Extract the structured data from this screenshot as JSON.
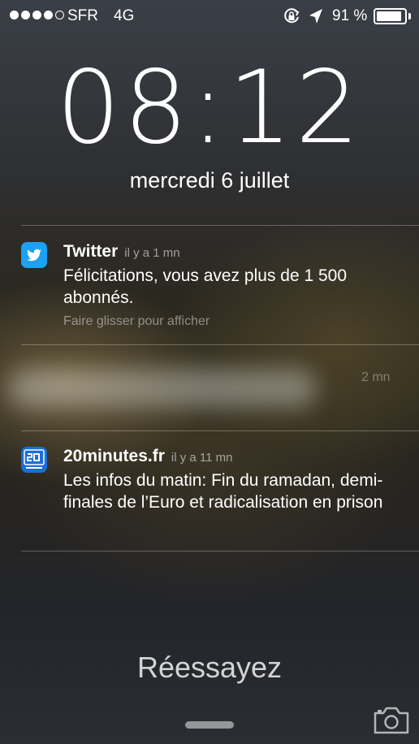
{
  "status_bar": {
    "carrier": "SFR",
    "network": "4G",
    "signal_filled": 4,
    "signal_total": 5,
    "battery_percent": "91 %",
    "battery_level": 0.91
  },
  "lock": {
    "time": "08:12",
    "date": "mercredi 6 juillet"
  },
  "notifications": [
    {
      "app": "Twitter",
      "time": "il y a 1 mn",
      "body": "Félicitations, vous avez plus de 1 500 abonnés.",
      "hint": "Faire glisser pour afficher",
      "icon": "twitter-icon",
      "color": "#1da1f2"
    },
    {
      "time": "2 mn"
    },
    {
      "app": "20minutes.fr",
      "time": "il y a 11 mn",
      "body": "Les infos du matin: Fin du ramadan, demi-finales de l’Euro et radicalisation en prison",
      "icon": "20minutes-icon",
      "color": "#1a6fd6"
    }
  ],
  "footer": {
    "message": "Réessayez",
    "camera_icon": "camera-icon"
  }
}
